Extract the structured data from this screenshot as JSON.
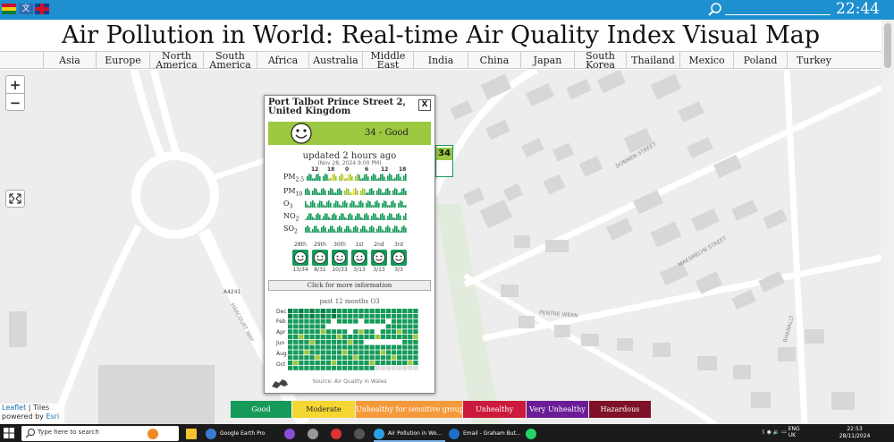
{
  "window": {
    "clock": "22:44"
  },
  "page": {
    "title": "Air Pollution in World: Real-time Air Quality Index Visual Map"
  },
  "nav": [
    "Asia",
    "Europe",
    "North America",
    "South America",
    "Africa",
    "Australia",
    "Middle East",
    "India",
    "China",
    "Japan",
    "South Korea",
    "Thailand",
    "Mexico",
    "Poland",
    "Turkey"
  ],
  "map": {
    "zoom_in": "+",
    "zoom_out": "−",
    "marker_value": "34",
    "streets": [
      "DONNEN STREET",
      "MAESMELYN STREET",
      "PENTRE WERN",
      "HARCOURT WAY",
      "RHANALLT",
      "A4241"
    ],
    "attribution": {
      "leaflet": "Leaflet",
      "sep": " | Tiles",
      "powered": "powered by ",
      "esri": "Esri"
    }
  },
  "popup": {
    "station": "Port Talbot Prince Street 2, United Kingdom",
    "close": "X",
    "aqi_text": "34 - Good",
    "updated": "updated 2 hours ago",
    "updated_date": "(Nov 28, 2024 9:00 PM)",
    "hour_ticks": [
      "12",
      "18",
      "0",
      "6",
      "12",
      "18"
    ],
    "pollutants": [
      "PM2.5",
      "PM10",
      "O3",
      "NO2",
      "SO2"
    ],
    "forecast": [
      {
        "day": "28th",
        "range": "13/34"
      },
      {
        "day": "29th",
        "range": "8/31"
      },
      {
        "day": "30th",
        "range": "10/33"
      },
      {
        "day": "1st",
        "range": "3/13"
      },
      {
        "day": "2nd",
        "range": "3/13"
      },
      {
        "day": "3rd",
        "range": "3/3"
      }
    ],
    "more_button": "Click for more information",
    "past_label": "past 12 months O3",
    "months": [
      "Dec",
      "Feb",
      "Apr",
      "Jun",
      "Aug",
      "Oct"
    ],
    "source": "Source: Air Quality in Wales"
  },
  "legend": [
    {
      "label": "Good",
      "color": "#159a5a"
    },
    {
      "label": "Moderate",
      "color": "#f5d733"
    },
    {
      "label": "Unhealthy for sensitive groups",
      "color": "#f59a3a"
    },
    {
      "label": "Unhealthy",
      "color": "#cc1a3c"
    },
    {
      "label": "Very Unhealthy",
      "color": "#6a1d96"
    },
    {
      "label": "Hazardous",
      "color": "#7e1128"
    }
  ],
  "taskbar": {
    "search_placeholder": "Type here to search",
    "apps": [
      "Google Earth Pro",
      "Air Pollution in Wo...",
      "Email - Graham But..."
    ],
    "lang": "ENG\nUK",
    "time": "22:53",
    "date": "28/11/2024"
  }
}
